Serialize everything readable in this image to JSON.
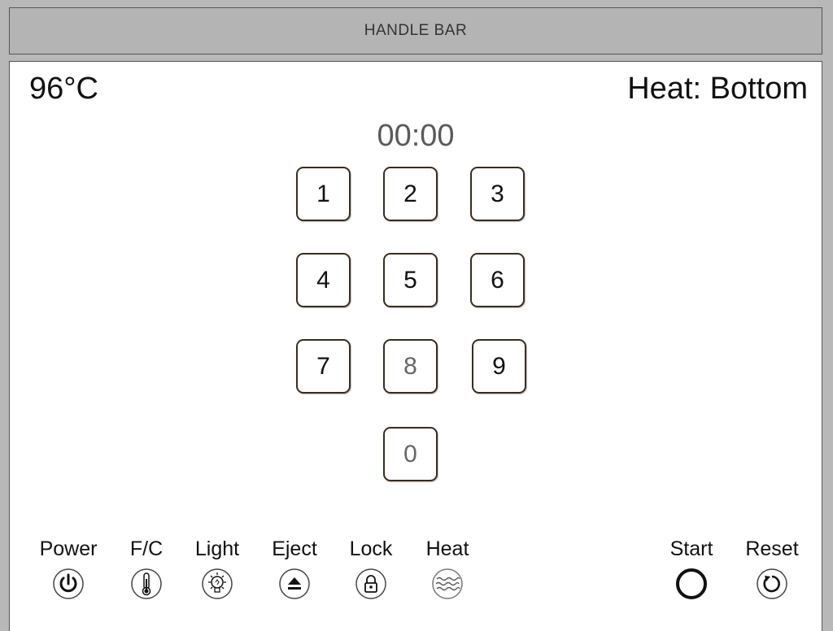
{
  "handle_bar": {
    "label": "HANDLE BAR"
  },
  "display": {
    "temperature": "96°C",
    "heat_mode": "Heat: Bottom",
    "timer": "00:00"
  },
  "keypad": {
    "keys": [
      "1",
      "2",
      "3",
      "4",
      "5",
      "6",
      "7",
      "8",
      "9",
      "0"
    ]
  },
  "controls": {
    "power": {
      "label": "Power",
      "icon": "power-icon"
    },
    "fc": {
      "label": "F/C",
      "icon": "thermometer-icon"
    },
    "light": {
      "label": "Light",
      "icon": "lightbulb-icon"
    },
    "eject": {
      "label": "Eject",
      "icon": "eject-icon"
    },
    "lock": {
      "label": "Lock",
      "icon": "lock-icon"
    },
    "heat": {
      "label": "Heat",
      "icon": "heat-waves-icon"
    },
    "start": {
      "label": "Start",
      "icon": "ring-icon"
    },
    "reset": {
      "label": "Reset",
      "icon": "reset-icon"
    }
  }
}
